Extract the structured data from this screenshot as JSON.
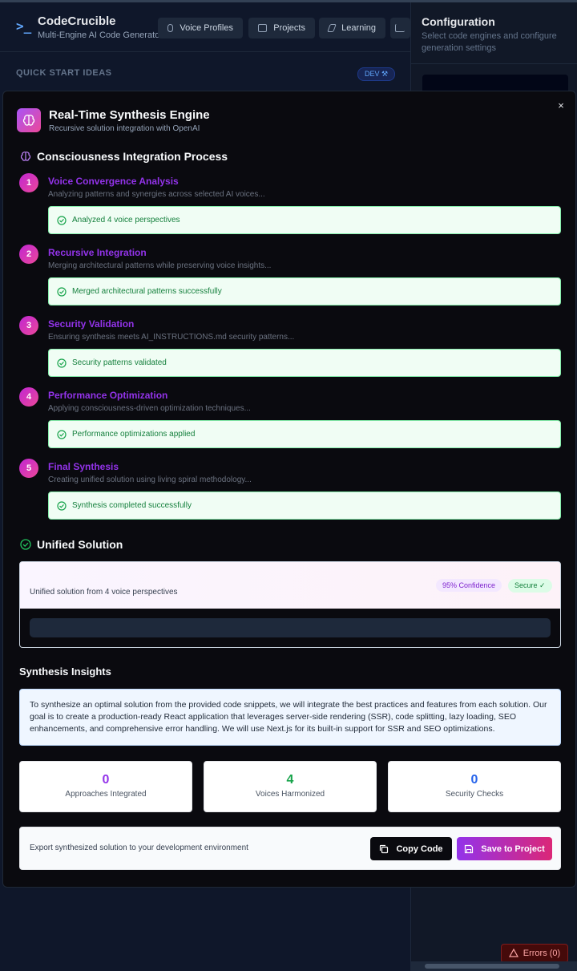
{
  "background": {
    "app_title": "CodeCrucible",
    "app_subtitle": "Multi-Engine AI Code Generator",
    "nav": [
      {
        "label": "Voice Profiles",
        "icon": "user-icon"
      },
      {
        "label": "Projects",
        "icon": "folder-icon"
      },
      {
        "label": "Learning",
        "icon": "graduation-cap-icon"
      }
    ],
    "quick_start_label": "QUICK START IDEAS",
    "dev_badge": "DEV",
    "config_title": "Configuration",
    "config_subtitle": "Select code engines and configure generation settings",
    "errors_label": "Errors (0)"
  },
  "modal": {
    "title": "Real-Time Synthesis Engine",
    "subtitle": "Recursive solution integration with OpenAI",
    "close_label": "×",
    "process_title": "Consciousness Integration Process",
    "steps": [
      {
        "num": "1",
        "title": "Voice Convergence Analysis",
        "desc": "Analyzing patterns and synergies across selected AI voices...",
        "result": "Analyzed 4 voice perspectives"
      },
      {
        "num": "2",
        "title": "Recursive Integration",
        "desc": "Merging architectural patterns while preserving voice insights...",
        "result": "Merged architectural patterns successfully"
      },
      {
        "num": "3",
        "title": "Security Validation",
        "desc": "Ensuring synthesis meets AI_INSTRUCTIONS.md security patterns...",
        "result": "Security patterns validated"
      },
      {
        "num": "4",
        "title": "Performance Optimization",
        "desc": "Applying consciousness-driven optimization techniques...",
        "result": "Performance optimizations applied"
      },
      {
        "num": "5",
        "title": "Final Synthesis",
        "desc": "Creating unified solution using living spiral methodology...",
        "result": "Synthesis completed successfully"
      }
    ],
    "unified_title": "Unified Solution",
    "unified_desc": "Unified solution from 4 voice perspectives",
    "confidence_badge": "95% Confidence",
    "secure_badge": "Secure ✓",
    "insights_title": "Synthesis Insights",
    "insights_text": "To synthesize an optimal solution from the provided code snippets, we will integrate the best practices and features from each solution. Our goal is to create a production-ready React application that leverages server-side rendering (SSR), code splitting, lazy loading, SEO enhancements, and comprehensive error handling. We will use Next.js for its built-in support for SSR and SEO optimizations.",
    "stats": [
      {
        "value": "0",
        "label": "Approaches Integrated",
        "color": "#9333ea"
      },
      {
        "value": "4",
        "label": "Voices Harmonized",
        "color": "#16a34a"
      },
      {
        "value": "0",
        "label": "Security Checks",
        "color": "#2563eb"
      }
    ],
    "export_text": "Export synthesized solution to your development environment",
    "copy_label": "Copy Code",
    "save_label": "Save to Project"
  }
}
